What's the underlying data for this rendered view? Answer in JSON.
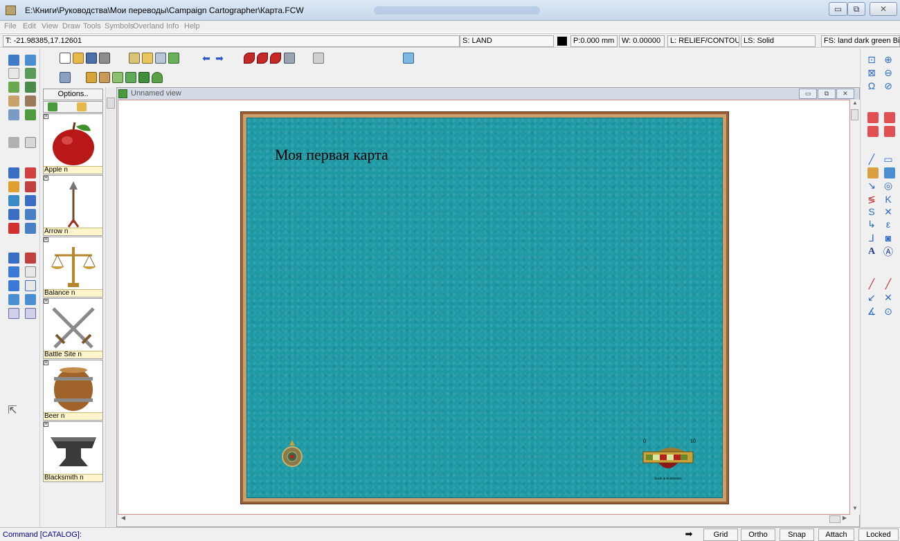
{
  "window": {
    "title": "E:\\Книги\\Руководства\\Мои переводы\\Campaign Cartographer\\Карта.FCW",
    "minimize_label": "▭",
    "maximize_label": "⧉",
    "close_label": "✕"
  },
  "menu": [
    "File",
    "Edit",
    "View",
    "Draw",
    "Tools",
    "Symbols",
    "Overland",
    "Info",
    "Help"
  ],
  "status": {
    "coords": "T: -21.98385,17.12601",
    "sheet": "S: LAND",
    "pen": "P:0.000 mm",
    "width": "W: 0.00000",
    "layer": "L: RELIEF/CONTOURS",
    "line_style": "LS: Solid",
    "fill_style": "FS: land dark green Bitmap",
    "color_swatch": "#000000"
  },
  "catalog": {
    "options_label": "Options..",
    "items": [
      {
        "label": "Apple n",
        "icon": "apple-icon"
      },
      {
        "label": "Arrow n",
        "icon": "arrow-icon"
      },
      {
        "label": "Balance n",
        "icon": "balance-icon"
      },
      {
        "label": "Battle Site n",
        "icon": "crossed-swords-icon"
      },
      {
        "label": "Beer n",
        "icon": "barrel-icon"
      },
      {
        "label": "Blacksmith n",
        "icon": "anvil-icon"
      }
    ]
  },
  "view": {
    "title": "Unnamed view",
    "map_title": "Моя первая карта",
    "scale_min": "0",
    "scale_max": "10",
    "scale_caption": "Scale in Kilometers"
  },
  "command": {
    "prompt": "Command [CATALOG]:",
    "buttons": [
      "Grid",
      "Ortho",
      "Snap",
      "Attach",
      "Locked"
    ]
  },
  "colors": {
    "sea": "#1f9aa5",
    "frame": "#9b5f35",
    "canvas_border": "#d08a8a"
  }
}
